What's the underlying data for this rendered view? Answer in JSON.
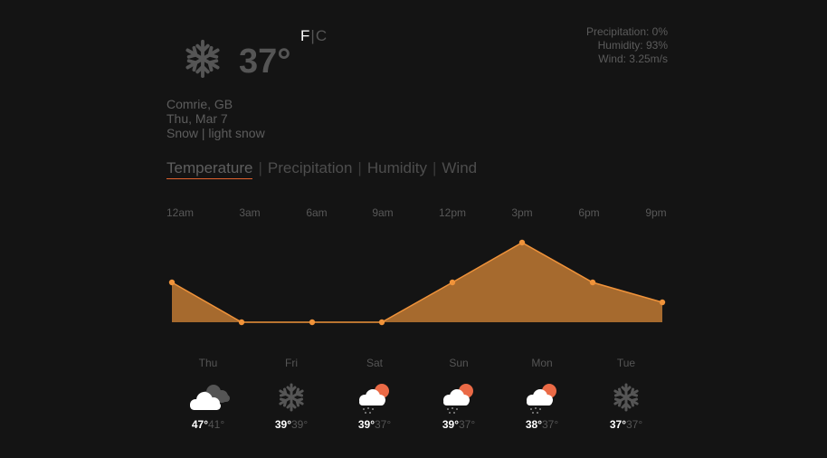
{
  "current": {
    "icon": "snowflake-icon",
    "temperature": "37°",
    "unit_f": "F",
    "unit_separator": "|",
    "unit_c": "C",
    "precipitation": "Precipitation: 0%",
    "humidity": "Humidity: 93%",
    "wind": "Wind: 3.25m/s",
    "location": "Comrie, GB",
    "date": "Thu, Mar 7",
    "condition": "Snow | light snow"
  },
  "tabs": [
    {
      "label": "Temperature",
      "active": true
    },
    {
      "label": "Precipitation",
      "active": false
    },
    {
      "label": "Humidity",
      "active": false
    },
    {
      "label": "Wind",
      "active": false
    }
  ],
  "tab_separator": "|",
  "colors": {
    "accent": "#e0622e",
    "chart_line": "#f0933a",
    "chart_fill": "#a66a2e",
    "background": "#141414"
  },
  "chart_data": {
    "type": "area",
    "x": [
      "12am",
      "3am",
      "6am",
      "9am",
      "12pm",
      "3pm",
      "6pm",
      "9pm"
    ],
    "series": [
      {
        "values": [
          39,
          37,
          37,
          37,
          39,
          41,
          39,
          38
        ]
      }
    ],
    "ylim": [
      37,
      41
    ],
    "grid": false
  },
  "forecast": [
    {
      "day": "Thu",
      "icon": "cloudy-icon",
      "high": "47°",
      "low": "41°"
    },
    {
      "day": "Fri",
      "icon": "snowflake-icon",
      "high": "39°",
      "low": "39°"
    },
    {
      "day": "Sat",
      "icon": "sun-cloud-rain-icon",
      "high": "39°",
      "low": "37°"
    },
    {
      "day": "Sun",
      "icon": "sun-cloud-rain-icon",
      "high": "39°",
      "low": "37°"
    },
    {
      "day": "Mon",
      "icon": "sun-cloud-rain-icon",
      "high": "38°",
      "low": "37°"
    },
    {
      "day": "Tue",
      "icon": "snowflake-icon",
      "high": "37°",
      "low": "37°"
    }
  ]
}
